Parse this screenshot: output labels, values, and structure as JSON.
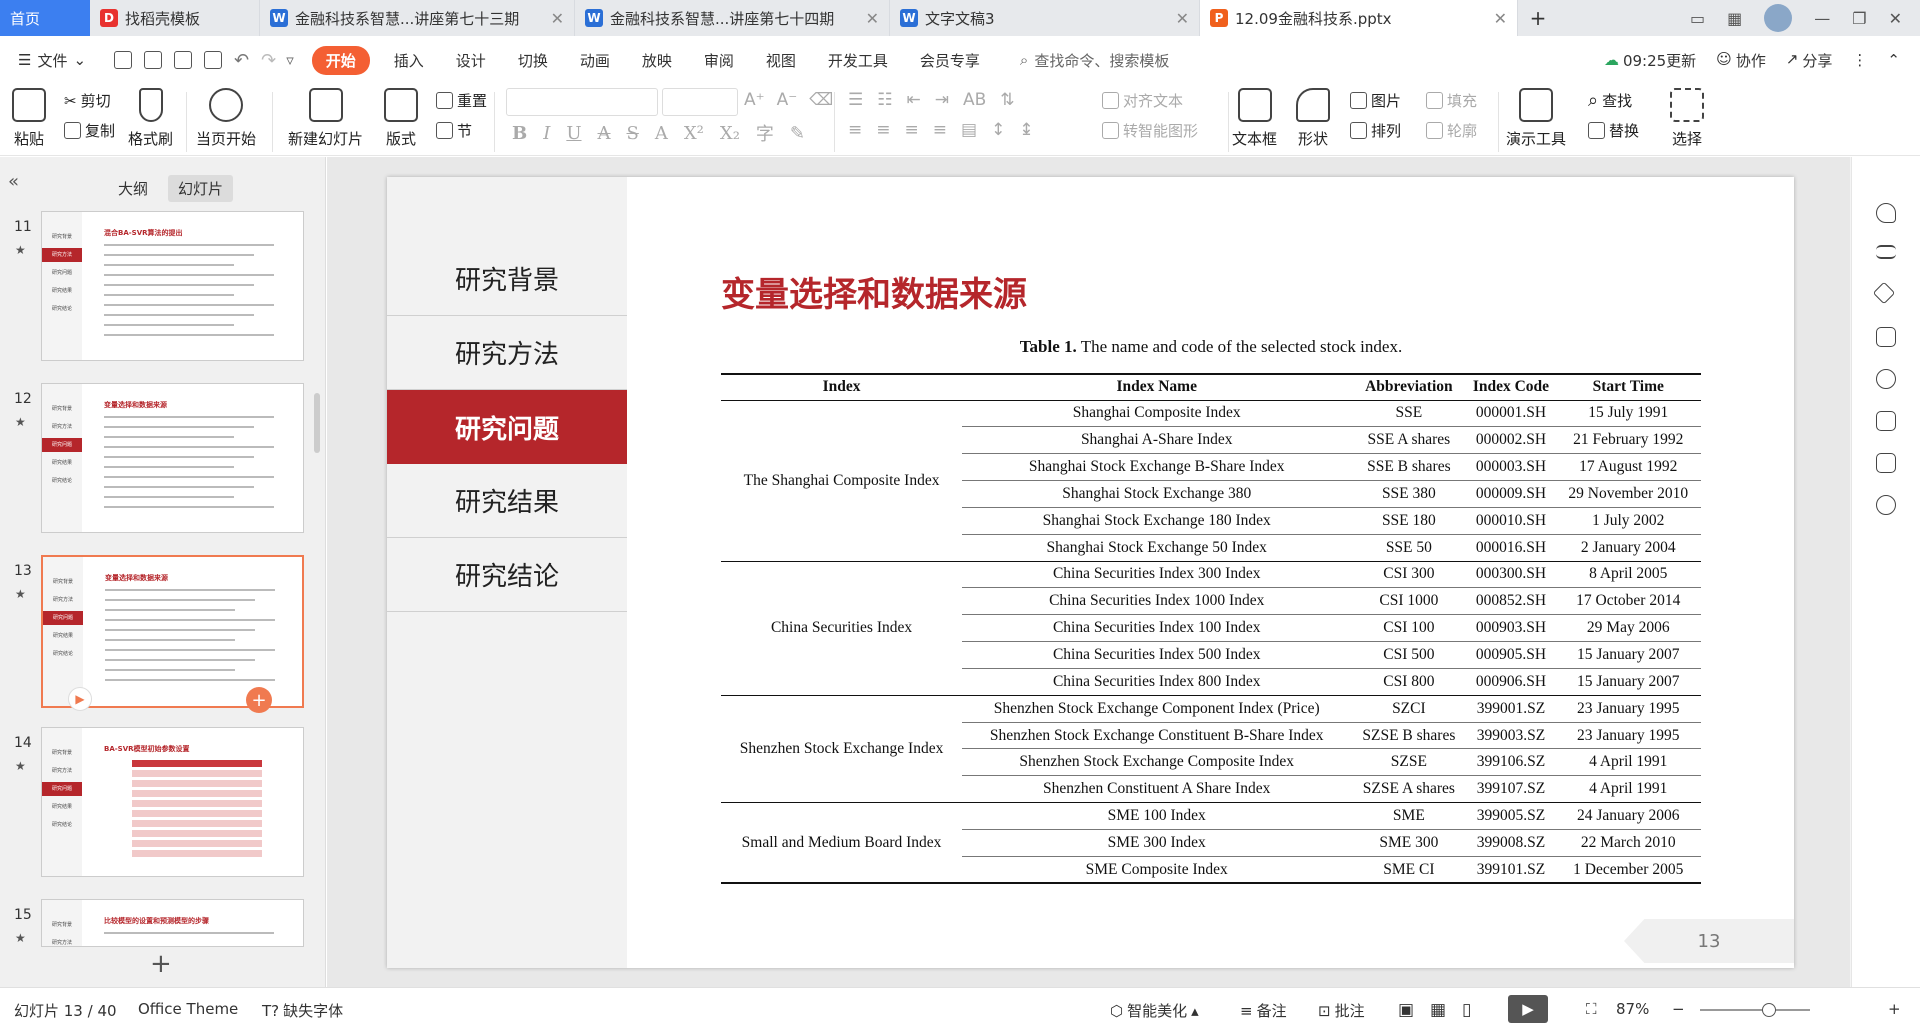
{
  "tabs": [
    {
      "label": "首页",
      "type": "home"
    },
    {
      "label": "找稻壳模板",
      "icon": "docer-icon",
      "color": "#e8322f"
    },
    {
      "label": "金融科技系智慧...讲座第七十三期",
      "icon": "word-icon",
      "color": "#2b6fd6"
    },
    {
      "label": "金融科技系智慧...讲座第七十四期",
      "icon": "word-icon",
      "color": "#2b6fd6"
    },
    {
      "label": "文字文稿3",
      "icon": "word-icon",
      "color": "#2b6fd6"
    },
    {
      "label": "12.09金融科技系.pptx",
      "icon": "ppt-icon",
      "color": "#f0601d",
      "active": true
    }
  ],
  "menu": {
    "file": "文件",
    "items": [
      "开始",
      "插入",
      "设计",
      "切换",
      "动画",
      "放映",
      "审阅",
      "视图",
      "开发工具",
      "会员专享"
    ],
    "active": "开始",
    "search": "查找命令、搜索模板",
    "time": "09:25更新",
    "collab": "协作",
    "share": "分享"
  },
  "ribbon": {
    "paste": "粘贴",
    "cut": "剪切",
    "copy": "复制",
    "format_painter": "格式刷",
    "from_current": "当页开始",
    "new_slide": "新建幻灯片",
    "layout": "版式",
    "reset": "重置",
    "section": "节",
    "align_text": "对齐文本",
    "convert_smart": "转智能图形",
    "textbox": "文本框",
    "shape": "形状",
    "arrange": "排列",
    "picture": "图片",
    "fill": "填充",
    "outline": "轮廓",
    "presenter": "演示工具",
    "find": "查找",
    "replace": "替换",
    "select": "选择"
  },
  "left_panel": {
    "tab_outline": "大纲",
    "tab_slides": "幻灯片",
    "slides": [
      {
        "num": "11",
        "title": "混合BA-SVR算法的提出"
      },
      {
        "num": "12",
        "title": "变量选择和数据来源"
      },
      {
        "num": "13",
        "title": "变量选择和数据来源",
        "selected": true
      },
      {
        "num": "14",
        "title": "BA-SVR模型初始参数设置"
      },
      {
        "num": "15",
        "title": "比较模型的设置和预测模型的步骤"
      }
    ],
    "thumb_nav": [
      "研究背景",
      "研究方法",
      "研究问题",
      "研究结果",
      "研究结论"
    ]
  },
  "slide": {
    "nav": [
      "研究背景",
      "研究方法",
      "研究问题",
      "研究结果",
      "研究结论"
    ],
    "active_nav": "研究问题",
    "title": "变量选择和数据来源",
    "caption_bold": "Table 1.",
    "caption": " The name and code of the selected stock index.",
    "headers": [
      "Index",
      "Index Name",
      "Abbreviation",
      "Index Code",
      "Start Time"
    ],
    "groups": [
      {
        "name": "The Shanghai Composite Index",
        "rows": [
          [
            "Shanghai Composite Index",
            "SSE",
            "000001.SH",
            "15 July 1991"
          ],
          [
            "Shanghai A-Share Index",
            "SSE A shares",
            "000002.SH",
            "21 February 1992"
          ],
          [
            "Shanghai Stock Exchange B-Share Index",
            "SSE B shares",
            "000003.SH",
            "17 August 1992"
          ],
          [
            "Shanghai Stock Exchange 380",
            "SSE 380",
            "000009.SH",
            "29 November 2010"
          ],
          [
            "Shanghai Stock Exchange 180 Index",
            "SSE 180",
            "000010.SH",
            "1 July 2002"
          ],
          [
            "Shanghai Stock Exchange 50 Index",
            "SSE 50",
            "000016.SH",
            "2 January 2004"
          ]
        ]
      },
      {
        "name": "China Securities Index",
        "rows": [
          [
            "China Securities Index 300 Index",
            "CSI 300",
            "000300.SH",
            "8 April 2005"
          ],
          [
            "China Securities Index 1000 Index",
            "CSI 1000",
            "000852.SH",
            "17 October 2014"
          ],
          [
            "China Securities Index 100 Index",
            "CSI 100",
            "000903.SH",
            "29 May 2006"
          ],
          [
            "China Securities Index 500 Index",
            "CSI 500",
            "000905.SH",
            "15 January 2007"
          ],
          [
            "China Securities Index 800 Index",
            "CSI 800",
            "000906.SH",
            "15 January 2007"
          ]
        ]
      },
      {
        "name": "Shenzhen Stock Exchange Index",
        "rows": [
          [
            "Shenzhen Stock Exchange Component Index (Price)",
            "SZCI",
            "399001.SZ",
            "23 January 1995"
          ],
          [
            "Shenzhen Stock Exchange Constituent B-Share Index",
            "SZSE B shares",
            "399003.SZ",
            "23 January 1995"
          ],
          [
            "Shenzhen Stock Exchange Composite Index",
            "SZSE",
            "399106.SZ",
            "4 April 1991"
          ],
          [
            "Shenzhen Constituent A Share Index",
            "SZSE A shares",
            "399107.SZ",
            "4 April 1991"
          ]
        ]
      },
      {
        "name": "Small and Medium Board Index",
        "rows": [
          [
            "SME 100 Index",
            "SME",
            "399005.SZ",
            "24 January 2006"
          ],
          [
            "SME 300 Index",
            "SME 300",
            "399008.SZ",
            "22 March 2010"
          ],
          [
            "SME Composite Index",
            "SME CI",
            "399101.SZ",
            "1 December 2005"
          ]
        ]
      }
    ],
    "page_number": "13"
  },
  "status": {
    "slide_pos": "幻灯片 13 / 40",
    "theme": "Office Theme",
    "missing_font": "缺失字体",
    "beautify": "智能美化",
    "notes": "备注",
    "comments": "批注",
    "zoom": "87%"
  }
}
